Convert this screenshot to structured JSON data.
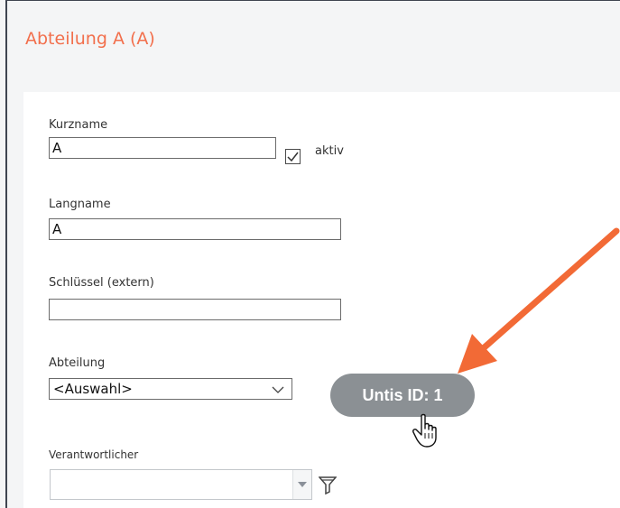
{
  "header": {
    "title": "Abteilung A (A)"
  },
  "form": {
    "kurzname": {
      "label": "Kurzname",
      "value": "A"
    },
    "aktiv": {
      "label": "aktiv",
      "checked": true
    },
    "langname": {
      "label": "Langname",
      "value": "A"
    },
    "schluessel": {
      "label": "Schlüssel (extern)",
      "value": ""
    },
    "abteilung": {
      "label": "Abteilung",
      "selected": "<Auswahl>"
    },
    "verantwortlicher": {
      "label": "Verantwortlicher",
      "value": ""
    }
  },
  "tooltip": {
    "text": "Untis ID: 1"
  },
  "icons": {
    "check": "checkmark-icon",
    "dropdown": "chevron-down-icon",
    "filter": "filter-icon",
    "pointer": "hand-pointer-icon",
    "arrow": "annotation-arrow-icon"
  },
  "colors": {
    "title": "#f26f4c",
    "arrow": "#f26a36",
    "badge": "#8b9094"
  }
}
